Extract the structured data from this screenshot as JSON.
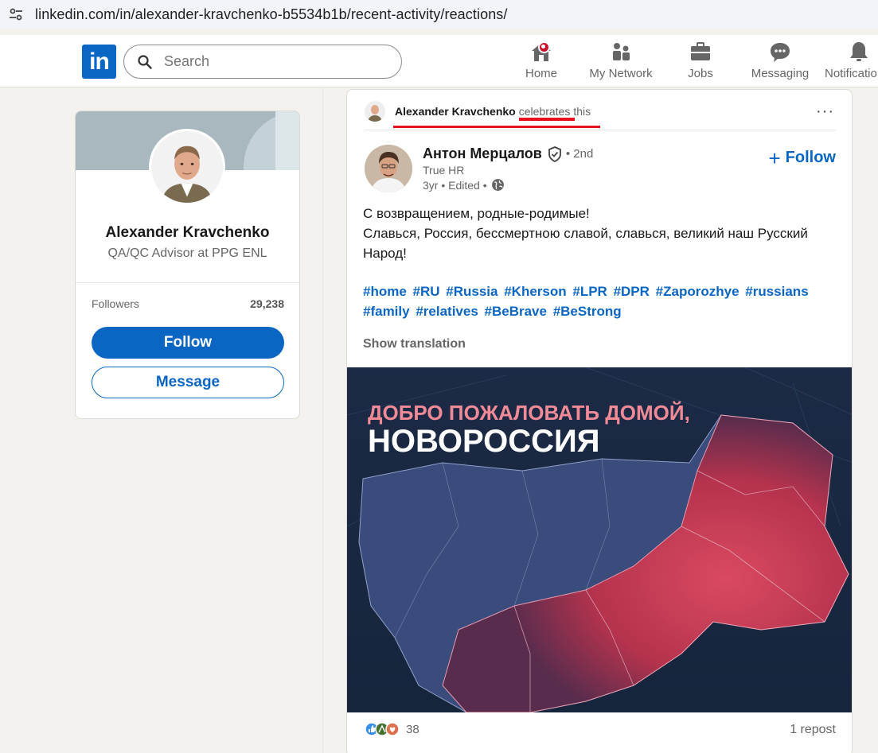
{
  "browser": {
    "url": "linkedin.com/in/alexander-kravchenko-b5534b1b/recent-activity/reactions/"
  },
  "nav": {
    "logo": "in",
    "search_placeholder": "Search",
    "items": [
      {
        "label": "Home",
        "icon": "home-icon"
      },
      {
        "label": "My Network",
        "icon": "network-icon"
      },
      {
        "label": "Jobs",
        "icon": "briefcase-icon"
      },
      {
        "label": "Messaging",
        "icon": "messaging-icon"
      },
      {
        "label": "Notificatio",
        "icon": "bell-icon"
      }
    ]
  },
  "profile": {
    "name": "Alexander Kravchenko",
    "headline": "QA/QC Advisor at PPG ENL",
    "followers_label": "Followers",
    "followers_count": "29,238",
    "follow_label": "Follow",
    "message_label": "Message"
  },
  "post": {
    "reactor_name": "Alexander Kravchenko",
    "reaction_verb": "celebrates",
    "reaction_suffix": "this",
    "more_label": "···",
    "author": {
      "name": "Антон Мерцалов",
      "degree": "• 2nd",
      "subtitle": "True HR",
      "meta": "3yr • Edited •",
      "follow_label": "Follow"
    },
    "text_lines": [
      "С возвращением, родные-родимые!",
      "Славься, Россия, бессмертною славой, славься, великий наш Русский",
      "Народ!"
    ],
    "hashtags": [
      "#home",
      "#RU",
      "#Russia",
      "#Kherson",
      "#LPR",
      "#DPR",
      "#Zaporozhye",
      "#russians",
      "#family",
      "#relatives",
      "#BeBrave",
      "#BeStrong"
    ],
    "show_translation": "Show translation",
    "image": {
      "line1": "ДОБРО ПОЖАЛОВАТЬ ДОМОЙ,",
      "line2": "НОВОРОССИЯ"
    },
    "reactions_count": "38",
    "reposts": "1 repost"
  },
  "colors": {
    "brand": "#0a66c2",
    "highlight": "#e8101e",
    "badge": "#cb112d"
  }
}
